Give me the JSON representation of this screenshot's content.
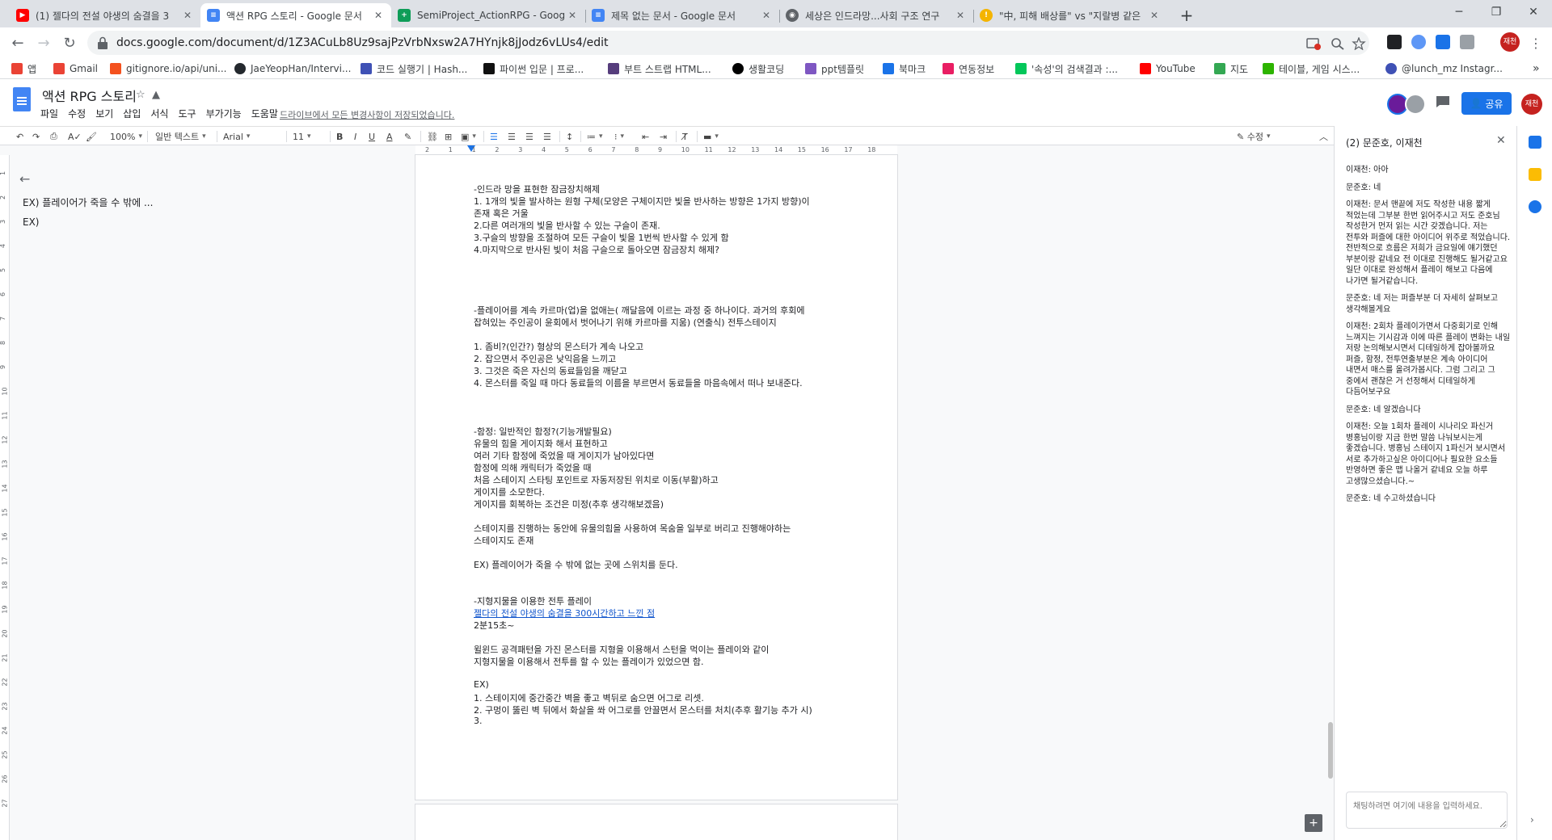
{
  "browser": {
    "tabs": [
      {
        "title": "(1) 젤다의 전설 야생의 숨결을 3",
        "icon": "youtube-icon",
        "color": "#ff0000"
      },
      {
        "title": "액션 RPG 스토리 - Google 문서",
        "icon": "docs-icon",
        "color": "#4285f4",
        "active": true
      },
      {
        "title": "SemiProject_ActionRPG - Googl",
        "icon": "sheets-icon",
        "color": "#0f9d58"
      },
      {
        "title": "제목 없는 문서 - Google 문서",
        "icon": "docs-icon",
        "color": "#4285f4"
      },
      {
        "title": "세상은 인드라망...사회 구조 연구",
        "icon": "globe-icon",
        "color": "#5f6368"
      },
      {
        "title": "\"中, 피해 배상를\" vs \"지랄병 같은",
        "icon": "news-icon",
        "color": "#f4b400"
      }
    ],
    "new_tab": "+",
    "url": "docs.google.com/document/d/1Z3ACuLb8Uz9sajPzVrbNxsw2A7HYnjk8jJodz6vLUs4/edit",
    "profile_label": "재천",
    "bookmarks": [
      {
        "label": "앱",
        "icon": "apps-icon",
        "color": "#ea4335"
      },
      {
        "label": "Gmail",
        "icon": "gmail-icon",
        "color": "#ea4335"
      },
      {
        "label": "gitignore.io/api/uni...",
        "icon": "gitignore-icon",
        "color": "#f4511e"
      },
      {
        "label": "JaeYeopHan/Intervi...",
        "icon": "github-icon",
        "color": "#24292e"
      },
      {
        "label": "코드 실행기 | Hash...",
        "icon": "hash-icon",
        "color": "#3f51b5"
      },
      {
        "label": "파이썬 입문 | 프로...",
        "icon": "python-icon",
        "color": "#111111"
      },
      {
        "label": "부트 스트랩  HTML...",
        "icon": "bootstrap-icon",
        "color": "#563d7c"
      },
      {
        "label": "생활코딩",
        "icon": "circle-icon",
        "color": "#000000"
      },
      {
        "label": "ppt템플릿",
        "icon": "ppt-icon",
        "color": "#7e57c2"
      },
      {
        "label": "북마크",
        "icon": "star-icon",
        "color": "#1a73e8"
      },
      {
        "label": "연동정보",
        "icon": "link-icon",
        "color": "#e91e63"
      },
      {
        "label": "'속성'의 검색결과 :...",
        "icon": "naver-icon",
        "color": "#03c75a"
      },
      {
        "label": "YouTube",
        "icon": "youtube-icon",
        "color": "#ff0000"
      },
      {
        "label": "지도",
        "icon": "maps-icon",
        "color": "#34a853"
      },
      {
        "label": "테이블, 게임 시스...",
        "icon": "chat-icon",
        "color": "#2db400"
      },
      {
        "label": "@lunch_mz Instagr...",
        "icon": "instagram-icon",
        "color": "#3f51b5"
      }
    ]
  },
  "docs": {
    "title": "액션 RPG 스토리",
    "menu": [
      "파일",
      "수정",
      "보기",
      "삽입",
      "서식",
      "도구",
      "부가기능",
      "도움말"
    ],
    "save_status": "드라이브에서 모든 변경사항이 저장되었습니다.",
    "share_label": "공유",
    "account_label": "재천",
    "toolbar": {
      "zoom": "100%",
      "style": "일반 텍스트",
      "font": "Arial",
      "size": "11",
      "mode": "수정"
    },
    "ruler_marks": [
      "2",
      "1",
      "1",
      "2",
      "3",
      "4",
      "5",
      "6",
      "7",
      "8",
      "9",
      "10",
      "11",
      "12",
      "13",
      "14",
      "15",
      "16",
      "17",
      "18"
    ],
    "vruler_marks": [
      "1",
      "2",
      "3",
      "4",
      "5",
      "6",
      "7",
      "8",
      "9",
      "10",
      "11",
      "12",
      "13",
      "14",
      "15",
      "16",
      "17",
      "18",
      "19",
      "20",
      "21",
      "22",
      "23",
      "24",
      "25",
      "26",
      "27"
    ],
    "outline": [
      "EX) 플레이어가 죽을 수 밖에 ...",
      "EX)"
    ],
    "body_lines": [
      {
        "text": "-인드라 망을 표현한 잠금장치해제"
      },
      {
        "text": "1. 1개의 빛을 발사하는 원형 구체(모양은 구체이지만 빛을 반사하는 방향은 1가지 방향)이"
      },
      {
        "text": "존재 혹은 거울"
      },
      {
        "text": "2.다른 여러개의 빛을 반사할 수 있는 구슬이 존재."
      },
      {
        "text": "3.구슬의 방향을 조절하여 모든 구슬이 빛을 1번씩 반사할 수 있게 함"
      },
      {
        "text": "4.마지막으로 반사된 빛이 처음 구슬으로 돌아오면 잠금장치 해제?"
      },
      {
        "text": "-플레이어를 계속 카르마(업)을 없애는( 깨달음에 이르는 과정 중 하나이다. 과거의 후회에"
      },
      {
        "text": "잡혀있는 주인공이 윤회에서 벗어나기 위해 카르마를 지움) (연출식) 전투스테이지"
      },
      {
        "text": "1. 좀비?(인간?) 형상의 몬스터가 계속 나오고"
      },
      {
        "text": "2. 잡으면서 주인공은 낮익음을 느끼고"
      },
      {
        "text": "3. 그것은 죽은 자신의 동료들임을 깨닫고"
      },
      {
        "text": "4. 몬스터를 죽일 때 마다 동료들의 이름을 부르면서 동료들을 마음속에서 떠나 보내준다."
      },
      {
        "text": "-함정: 일반적인 함정?(기능개발필요)"
      },
      {
        "text": "유물의 힘을 게이지화 해서 표현하고"
      },
      {
        "text": "여러 기타 함정에 죽었을 때 게이지가 남아있다면"
      },
      {
        "text": "함정에 의해 캐릭터가 죽었을 때"
      },
      {
        "text": "처음 스테이지 스타팅 포인트로 자동저장된 위치로 이동(부활)하고"
      },
      {
        "text": "게이지를 소모한다."
      },
      {
        "text": "게이지를 회복하는 조건은 미정(추후 생각해보겠음)"
      },
      {
        "text": "스테이지를 진행하는 동안에 유물의힘을 사용하여 목숨을 일부로 버리고 진행해야하는"
      },
      {
        "text": "스테이지도 존재"
      },
      {
        "text": "EX) 플레이어가 죽을 수 밖에 없는 곳에 스위치를 둔다."
      },
      {
        "text": "-지형지물을 이용한 전투 플레이"
      },
      {
        "text": "젤다의 전설 야생의 숨결을 300시간하고 느낀 점",
        "link": true
      },
      {
        "text": "2분15초~"
      },
      {
        "text": "윌윈드 공격패턴을 가진 몬스터를 지형을 이용해서 스턴을 먹이는 플레이와 같이"
      },
      {
        "text": "지형지물을 이용해서 전투를 할 수 있는 플레이가 있었으면 함."
      },
      {
        "text": "EX)"
      },
      {
        "text": "1. 스테이지에 중간중간 벽을 좋고 벽뒤로 숨으면 어그로 리셋."
      },
      {
        "text": "2. 구멍이 뚫린 벽 뒤에서 화살을 쏴 어그로를 안끌면서 몬스터를 처치(추후 활기능 추가 시)"
      },
      {
        "text": "3."
      }
    ]
  },
  "chat": {
    "header": "(2) 문준호, 이재천",
    "messages": [
      "이재천: 아아",
      "문준호: 네",
      "이재천: 문서 맨끝에 저도 작성한 내용 짧게 적었는데 그부분 한번 읽어주시고 저도 준호님 작성한거 먼저 읽는 시간 갖겠습니다. 저는 전투와 퍼즐에 대한 아이디어 위주로 적었습니다. 전반적으로 흐름은 저희가 금요일에 얘기했던 부분이랑 같네요 전 이대로 진행해도 될거같고요 일단 이대로 완성해서 플레이 해보고 다음에 나가면 될거같습니다.",
      "문준호: 네 저는 퍼즐부분 더 자세히 살펴보고 생각해볼게요",
      "이재천: 2회차 플레이가면서 다중회기로 인해 느껴지는 기시감과 이에 따른 플레이 변화는 내일 저랑 논의해보시면서 디테일하게 잡아볼까요 퍼즐, 함정, 전투연출부분은 계속 아이디어 내면서 매스를 올려가봅시다. 그럼 그리고 그 중에서 괜찮은 거 선정해서 디테일하게 다듬어보구요",
      "문준호: 네 알겠습니다",
      "이재천: 오늘 1회차 플레이 시나리오 파신거 병홍님이랑 지금 한번 말씀 나눠보시는게 좋겠습니다. 병홍님 스테이지 1파신거 보시면서 서로 추가하고싶은 아이디어나 필요한 요소들 반영하면 좋은 맵 나올거 같네요 오늘 하루 고생많으셨습니다.~",
      "문준호: 네 수고하셨습니다"
    ],
    "input_placeholder": "채팅하려면 여기에 내용을 입력하세요."
  }
}
